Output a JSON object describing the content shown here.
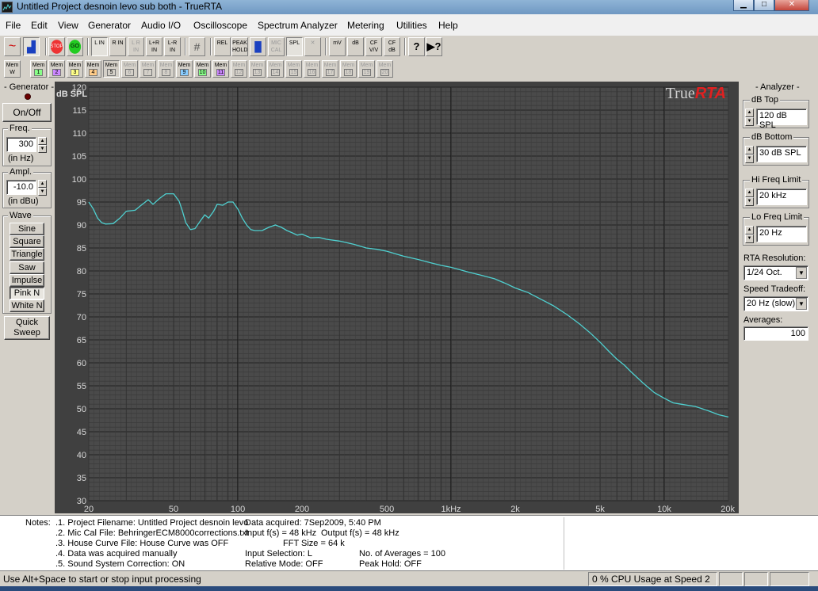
{
  "window": {
    "title": "Untitled Project desnoin levo sub both - TrueRTA"
  },
  "menu": [
    "File",
    "Edit",
    "View",
    "Generator",
    "Audio I/O",
    "Oscilloscope",
    "Spectrum Analyzer",
    "Metering",
    "Utilities",
    "Help"
  ],
  "toolbar": {
    "buttons": [
      {
        "name": "sine-wave-view-button",
        "label": "~"
      },
      {
        "name": "spectrum-view-button",
        "label": "▟"
      },
      {
        "name": "stop-button",
        "label": "STOP"
      },
      {
        "name": "go-button",
        "label": "GO"
      },
      {
        "name": "left-in-button",
        "label": "L IN"
      },
      {
        "name": "right-in-button",
        "label": "R IN"
      },
      {
        "name": "l-r-in-button",
        "label": "L R IN"
      },
      {
        "name": "l-plus-r-in-button",
        "label": "L+R IN"
      },
      {
        "name": "l-minus-r-in-button",
        "label": "L-R IN"
      },
      {
        "name": "grid-button",
        "label": "#"
      },
      {
        "name": "rel-button",
        "label": "REL"
      },
      {
        "name": "peak-hold-button",
        "label": "PEAK HOLD"
      },
      {
        "name": "bars-button",
        "label": "▐▌"
      },
      {
        "name": "mic-cal-button",
        "label": "MIC CAL"
      },
      {
        "name": "spl-button",
        "label": "SPL"
      },
      {
        "name": "clear-button",
        "label": "✕"
      },
      {
        "name": "mv-button",
        "label": "mV"
      },
      {
        "name": "db-button",
        "label": "dB"
      },
      {
        "name": "cf-vv-button",
        "label": "CF V/V"
      },
      {
        "name": "cf-db-button",
        "label": "CF dB"
      },
      {
        "name": "help-button",
        "label": "?"
      },
      {
        "name": "context-help-button",
        "label": "▶?"
      }
    ]
  },
  "memories": {
    "recall_label": "Mem",
    "recall_sub": "W",
    "items": [
      "1",
      "2",
      "3",
      "4",
      "5",
      "6",
      "7",
      "8",
      "9",
      "10",
      "11",
      "12",
      "13",
      "14",
      "15",
      "16",
      "17",
      "18",
      "19",
      "20"
    ]
  },
  "generator": {
    "title": "Generator",
    "onoff_label": "On/Off",
    "freq_label": "Freq.",
    "freq_value": "300",
    "freq_unit": "(in Hz)",
    "ampl_label": "Ampl.",
    "ampl_value": "-10.0",
    "ampl_unit": "(in dBu)",
    "wave_label": "Wave",
    "waves": [
      "Sine",
      "Square",
      "Triangle",
      "Saw",
      "Impulse",
      "Pink N",
      "White N"
    ],
    "quick_sweep_label": "Quick Sweep"
  },
  "analyzer": {
    "title": "Analyzer",
    "db_top_label": "dB Top",
    "db_top_value": "120 dB SPL",
    "db_bottom_label": "dB Bottom",
    "db_bottom_value": "30 dB SPL",
    "hi_freq_label": "Hi Freq Limit",
    "hi_freq_value": "20 kHz",
    "lo_freq_label": "Lo Freq Limit",
    "lo_freq_value": "20 Hz",
    "resolution_label": "RTA Resolution:",
    "resolution_value": "1/24 Oct.",
    "speed_label": "Speed Tradeoff:",
    "speed_value": "20 Hz (slow)",
    "averages_label": "Averages:",
    "averages_value": "100"
  },
  "chart_data": {
    "type": "line",
    "title": "",
    "brand_true": "True",
    "brand_rta": "RTA",
    "ylabel": "dB SPL",
    "xlabel": "",
    "x_scale": "log",
    "xlim": [
      20,
      20000
    ],
    "ylim": [
      30,
      120
    ],
    "y_ticks": [
      30,
      35,
      40,
      45,
      50,
      55,
      60,
      65,
      70,
      75,
      80,
      85,
      90,
      95,
      100,
      105,
      110,
      115,
      120
    ],
    "x_ticks": [
      {
        "value": 20,
        "label": "20"
      },
      {
        "value": 50,
        "label": "50"
      },
      {
        "value": 100,
        "label": "100"
      },
      {
        "value": 200,
        "label": "200"
      },
      {
        "value": 500,
        "label": "500"
      },
      {
        "value": 1000,
        "label": "1kHz"
      },
      {
        "value": 2000,
        "label": "2k"
      },
      {
        "value": 5000,
        "label": "5k"
      },
      {
        "value": 10000,
        "label": "10k"
      },
      {
        "value": 20000,
        "label": "20k"
      }
    ],
    "grid": true,
    "line_color": "#4fd0d0",
    "series": [
      {
        "x": [
          20,
          21,
          22,
          23,
          24,
          26,
          28,
          30,
          33,
          35,
          38,
          40,
          43,
          46,
          50,
          53,
          55,
          57,
          60,
          63,
          67,
          70,
          73,
          77,
          80,
          85,
          90,
          95,
          100,
          105,
          110,
          115,
          120,
          130,
          140,
          150,
          160,
          170,
          180,
          190,
          200,
          220,
          240,
          260,
          300,
          350,
          400,
          450,
          500,
          600,
          700,
          800,
          900,
          1000,
          1200,
          1400,
          1600,
          1800,
          2000,
          2300,
          2600,
          3000,
          3500,
          4000,
          4500,
          5000,
          5500,
          6000,
          6500,
          7000,
          8000,
          9000,
          10000,
          11000,
          12000,
          14000,
          16000,
          18000,
          20000
        ],
        "y": [
          95,
          93.5,
          91.5,
          90.5,
          90.2,
          90.3,
          91.5,
          93,
          93.2,
          94.2,
          95.5,
          94.5,
          95.8,
          96.8,
          96.8,
          95.2,
          93,
          90.5,
          89,
          89.2,
          91,
          92.2,
          91.5,
          93,
          94.5,
          94.3,
          95,
          95,
          93.5,
          91.5,
          90,
          89,
          88.8,
          88.8,
          89.5,
          90,
          89.5,
          88.8,
          88.3,
          87.8,
          88,
          87.2,
          87.3,
          86.9,
          86.5,
          85.8,
          85,
          84.7,
          84.3,
          83.2,
          82.5,
          81.8,
          81.2,
          80.8,
          79.8,
          79,
          78.3,
          77.3,
          76.3,
          75.3,
          74,
          72.5,
          70.5,
          68.5,
          66.5,
          64.5,
          62.5,
          60.8,
          59.5,
          58,
          55.5,
          53.5,
          52.3,
          51.3,
          51,
          50.5,
          49.6,
          48.7,
          48.2
        ]
      }
    ]
  },
  "notes": {
    "label": "Notes:",
    "lines": [
      ".1. Project Filename: Untitled Project desnoin levo",
      ".2. Mic Cal File: BehringerECM8000corrections.txt",
      ".3. House Curve File: House Curve was OFF",
      ".4. Data was acquired manually",
      ".5. Sound System Correction: ON"
    ],
    "data_acquired": "Data acquired: 7Sep2009, 5:40 PM",
    "input_fs": "Input f(s) = 48 kHz",
    "output_fs": "Output f(s) = 48 kHz",
    "fft_size": "FFT Size = 64 k",
    "input_selection": "Input Selection: L",
    "no_averages": "No. of Averages = 100",
    "relative_mode": "Relative Mode:  OFF",
    "peak_hold": "Peak Hold: OFF"
  },
  "status": {
    "hint": "Use Alt+Space to start or stop input processing",
    "cpu": "0 % CPU Usage at Speed 2"
  }
}
